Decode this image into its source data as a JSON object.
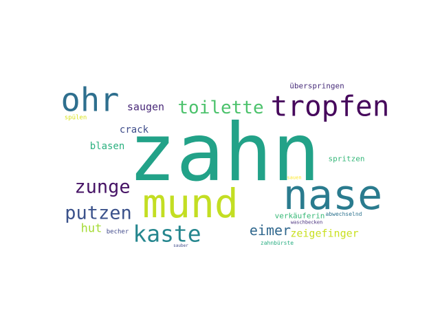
{
  "words": [
    {
      "text": "zahn",
      "color": "#22a288"
    },
    {
      "text": "nase",
      "color": "#2a7b8e"
    },
    {
      "text": "mund",
      "color": "#c3de23"
    },
    {
      "text": "tropfen",
      "color": "#46085c"
    },
    {
      "text": "ohr",
      "color": "#2e6f8e"
    },
    {
      "text": "toilette",
      "color": "#4cc26c"
    },
    {
      "text": "kaste",
      "color": "#25868e"
    },
    {
      "text": "zunge",
      "color": "#471466"
    },
    {
      "text": "putzen",
      "color": "#3b528b"
    },
    {
      "text": "saugen",
      "color": "#482878"
    },
    {
      "text": "eimer",
      "color": "#31688e"
    },
    {
      "text": "zeigefinger",
      "color": "#c9e020"
    },
    {
      "text": "crack",
      "color": "#3e4c8a"
    },
    {
      "text": "blasen",
      "color": "#2ab07f"
    },
    {
      "text": "hut",
      "color": "#a5db36"
    },
    {
      "text": "spritzen",
      "color": "#35b779"
    },
    {
      "text": "überspringen",
      "color": "#472c7a"
    },
    {
      "text": "verkäuferin",
      "color": "#38b977"
    },
    {
      "text": "spülen",
      "color": "#d8e219"
    },
    {
      "text": "becher",
      "color": "#3f4889"
    },
    {
      "text": "abwechselnd",
      "color": "#2c728e"
    },
    {
      "text": "waschbecken",
      "color": "#472e7c"
    },
    {
      "text": "zahnbürste",
      "color": "#27ad81"
    },
    {
      "text": "sauber",
      "color": "#3e4a89"
    },
    {
      "text": "sauen",
      "color": "#fde725"
    }
  ]
}
